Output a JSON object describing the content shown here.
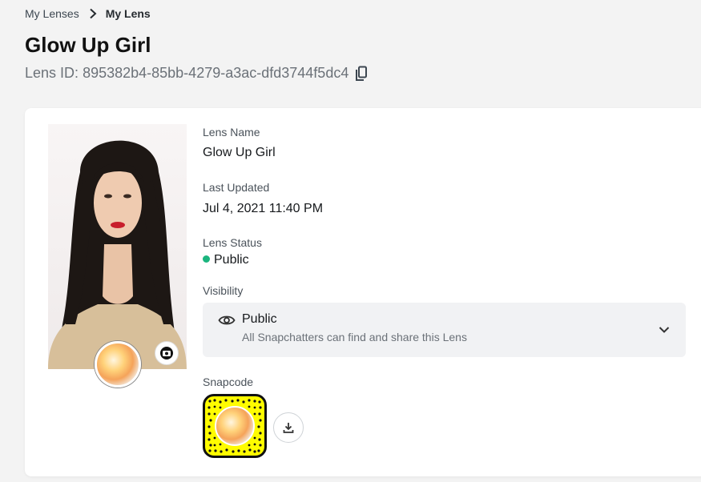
{
  "breadcrumb": {
    "parent": "My Lenses",
    "current": "My Lens"
  },
  "page": {
    "title": "Glow Up Girl",
    "lens_id_label": "Lens ID:",
    "lens_id_value": "895382b4-85bb-4279-a3ac-dfd3744f5dc4"
  },
  "details": {
    "lens_name_label": "Lens Name",
    "lens_name_value": "Glow Up Girl",
    "last_updated_label": "Last Updated",
    "last_updated_value": "Jul 4, 2021 11:40 PM",
    "status_label": "Lens Status",
    "status_value": "Public",
    "status_color": "#1bb57e",
    "visibility_label": "Visibility",
    "visibility_value": "Public",
    "visibility_description": "All Snapchatters can find and share this Lens",
    "snapcode_label": "Snapcode"
  },
  "icons": {
    "breadcrumb_separator": "chevron-right-icon",
    "copy": "copy-icon",
    "camera": "camera-icon",
    "visibility": "eye-icon",
    "dropdown": "chevron-down-icon",
    "download": "download-icon"
  },
  "colors": {
    "snapcode_yellow": "#fffc00",
    "page_background": "#f3f3f3"
  }
}
